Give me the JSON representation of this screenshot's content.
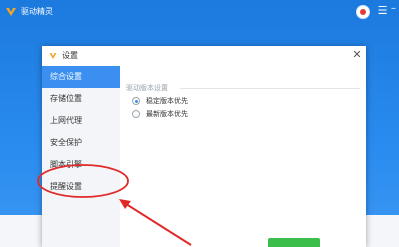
{
  "app": {
    "title": "驱动精灵"
  },
  "dialog": {
    "title": "设置",
    "sidebar": {
      "items": [
        {
          "label": "综合设置"
        },
        {
          "label": "存储位置"
        },
        {
          "label": "上网代理"
        },
        {
          "label": "安全保护"
        },
        {
          "label": "脚本引擎"
        },
        {
          "label": "提醒设置"
        }
      ]
    },
    "content": {
      "section_title": "驱动版本设置",
      "options": [
        {
          "label": "稳定版本优先",
          "checked": true
        },
        {
          "label": "最新版本优先",
          "checked": false
        }
      ]
    }
  },
  "colors": {
    "accent": "#3b8ff0",
    "annotation_red": "#e02a2a",
    "button_green": "#3bbf4a"
  },
  "icons": [
    "app-logo-icon",
    "shield-icon",
    "menu-icon",
    "minimize-icon",
    "settings-icon",
    "close-icon"
  ]
}
